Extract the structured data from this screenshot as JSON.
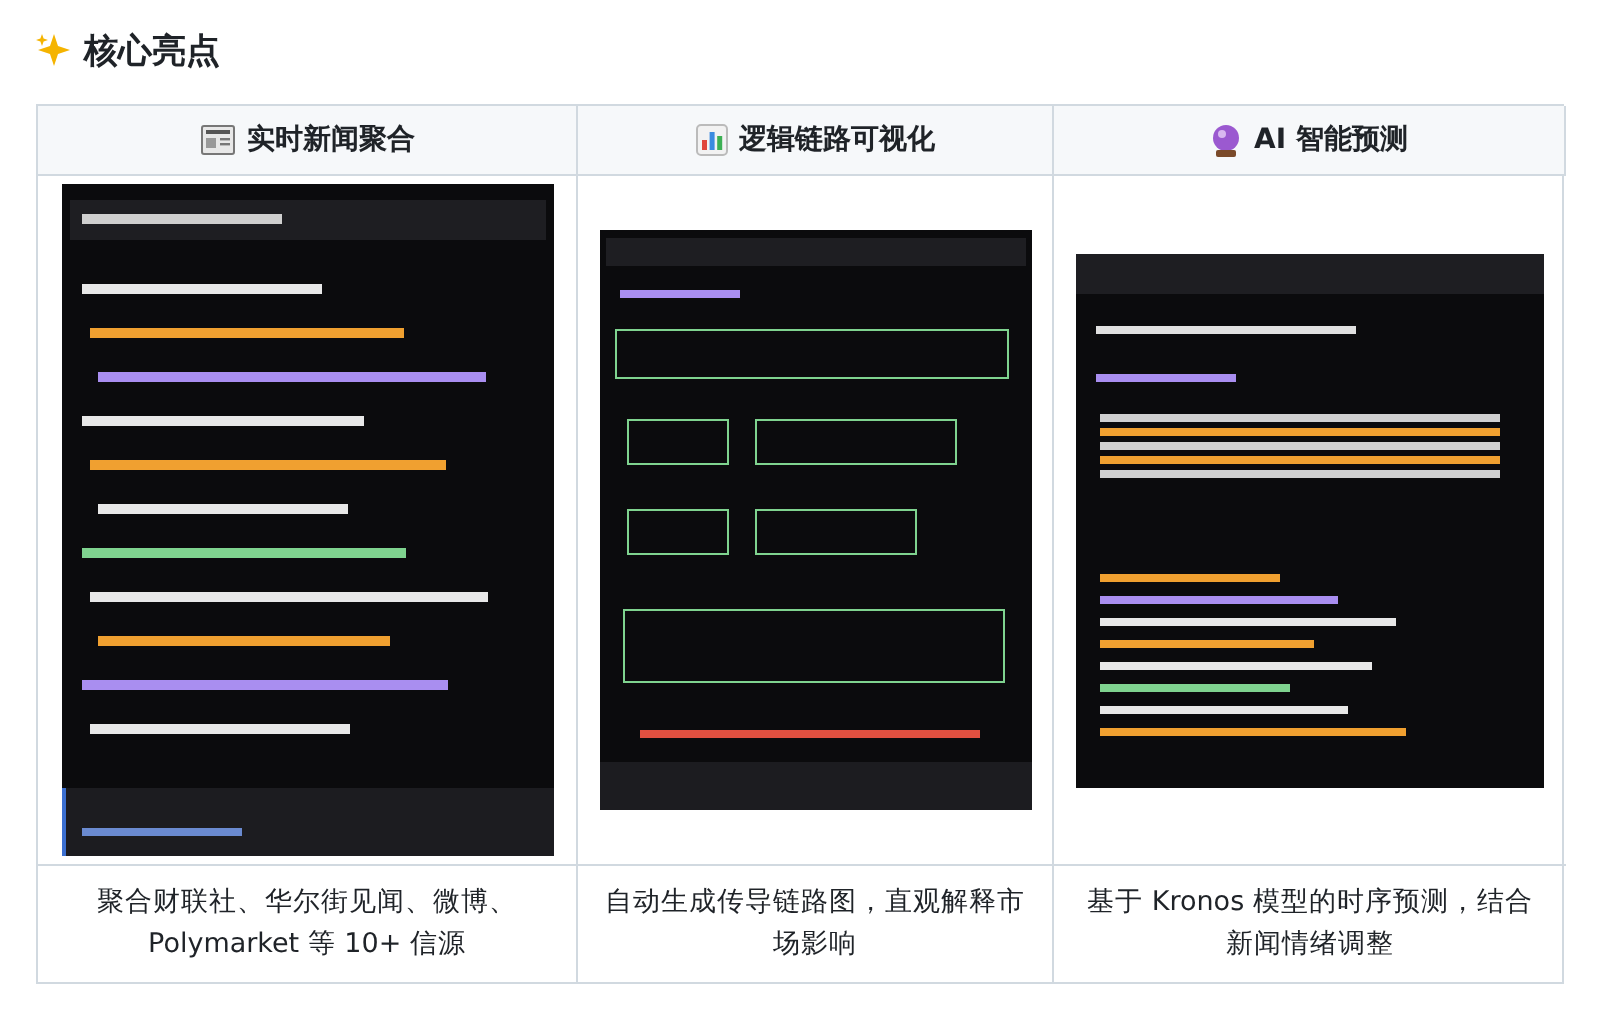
{
  "heading": {
    "title": "核心亮点"
  },
  "table": {
    "columns": [
      {
        "header": "实时新闻聚合",
        "caption": "聚合财联社、华尔街见闻、微博、Polymarket 等 10+ 信源"
      },
      {
        "header": "逻辑链路可视化",
        "caption": "自动生成传导链路图，直观解释市场影响"
      },
      {
        "header": "AI 智能预测",
        "caption": "基于 Kronos 模型的时序预测，结合新闻情绪调整"
      }
    ]
  }
}
